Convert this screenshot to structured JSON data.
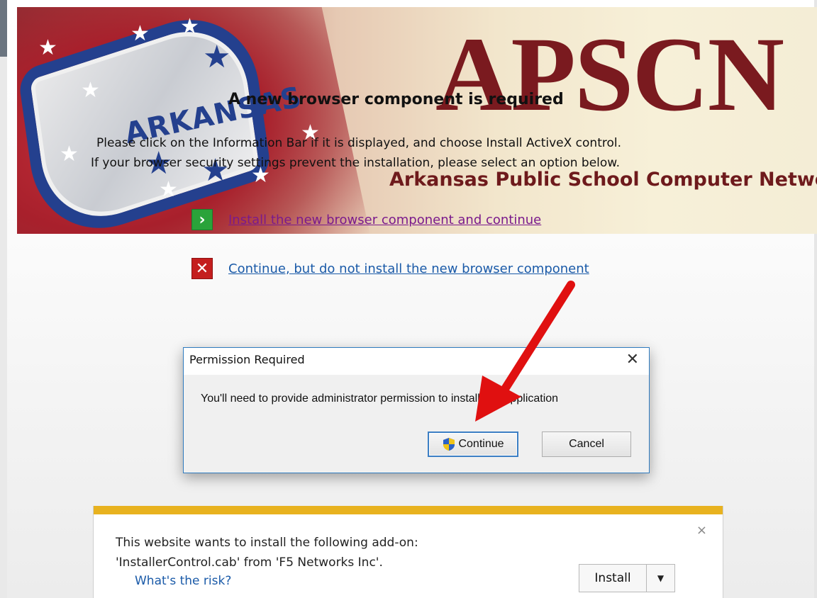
{
  "banner": {
    "logo": "APSCN",
    "subtitle": "Arkansas Public School Computer Network",
    "flag_word": "ARKANSAS"
  },
  "message": {
    "title": "A new browser component is required",
    "line1": "Please click on the Information Bar if it is displayed, and choose Install ActiveX control.",
    "line2": "If your browser security settings prevent the installation, please select an option below."
  },
  "options": {
    "install_label": "Install the new browser component and continue",
    "skip_label": "Continue, but do not install the new browser component",
    "install_icon": "chevron-right-icon",
    "skip_icon": "x-icon"
  },
  "dialog": {
    "title": "Permission Required",
    "text": "You'll need to provide administrator permission to install this application",
    "continue_label": "Continue",
    "cancel_label": "Cancel",
    "close_glyph": "✕"
  },
  "notification": {
    "line1": "This website wants to install the following add-on:",
    "line2": "'InstallerControl.cab' from 'F5 Networks Inc'.",
    "risk_link": "What's the risk?",
    "install_label": "Install",
    "close_glyph": "×"
  },
  "colors": {
    "accent_bar": "#e8b21f",
    "logo": "#7a1a1f",
    "link_blue": "#1a5aa8",
    "link_visited": "#7a1a8c",
    "arrow": "#e01010"
  }
}
